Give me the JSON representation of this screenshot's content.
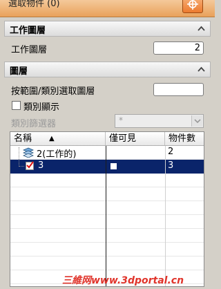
{
  "top": {
    "label": "選取物件 (0)"
  },
  "work_layer_section": {
    "title": "工作圖層",
    "field_label": "工作圖層",
    "field_value": "2"
  },
  "layer_section": {
    "title": "圖層",
    "select_by_range_label": "按範圍/類別選取圖層",
    "select_by_range_value": "",
    "show_category_label": "類別顯示",
    "show_category_checked": false,
    "category_filter_label": "類別篩選器",
    "category_filter_value": "*"
  },
  "table": {
    "columns": [
      "名稱",
      "僅可見",
      "物件數"
    ],
    "sort_indicator": "▲",
    "rows": [
      {
        "name": "2(工作的)",
        "visible_only": "",
        "count": "2",
        "selected": false,
        "work_layer": true
      },
      {
        "name": "3",
        "visible_only": "",
        "count": "3",
        "selected": true,
        "work_layer": false
      }
    ]
  },
  "watermark": "三維网www.3dportal.cn",
  "colors": {
    "selection": "#0a246a",
    "accent_orange": "#ec7a2e",
    "watermark": "#e0332a"
  }
}
